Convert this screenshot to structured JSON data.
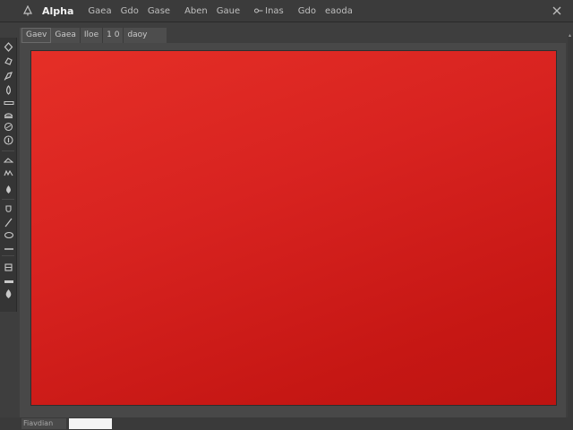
{
  "menubar": {
    "items": [
      {
        "label": "Alpha",
        "active": true
      },
      {
        "label": "Gaea"
      },
      {
        "label": "Gdo"
      },
      {
        "label": "Gase"
      },
      {
        "label": "Aben"
      },
      {
        "label": "Gaue"
      },
      {
        "label": "Inas"
      },
      {
        "label": "Gdo"
      },
      {
        "label": "eaoda"
      }
    ],
    "app_icon": "tree-icon",
    "window_control": "close-icon"
  },
  "options": {
    "items": [
      {
        "label": "Gaev"
      },
      {
        "label": "Gaea"
      },
      {
        "label": "Iloe"
      },
      {
        "label": "1 0"
      },
      {
        "label": "daoy"
      }
    ]
  },
  "toolbar": {
    "tools": [
      {
        "name": "move-tool",
        "icon": "move-icon"
      },
      {
        "name": "marquee-tool",
        "icon": "marquee-icon"
      },
      {
        "name": "lasso-tool",
        "icon": "lasso-icon"
      },
      {
        "name": "brush-tool",
        "icon": "brush-icon"
      },
      {
        "name": "line-tool",
        "icon": "line-icon"
      },
      {
        "name": "stamp-tool",
        "icon": "stamp-icon"
      },
      {
        "name": "eraser-tool",
        "icon": "eraser-icon"
      },
      {
        "name": "info-tool",
        "icon": "info-icon"
      },
      {
        "name": "shape-tool",
        "icon": "shape-icon"
      },
      {
        "name": "path-tool",
        "icon": "path-icon"
      },
      {
        "name": "fill-tool",
        "icon": "fill-icon"
      },
      {
        "name": "dodge-tool",
        "icon": "dodge-icon"
      },
      {
        "name": "pen-tool",
        "icon": "pen-icon"
      },
      {
        "name": "text-tool",
        "icon": "text-icon"
      },
      {
        "name": "hand-tool",
        "icon": "hand-icon"
      },
      {
        "name": "zoom-tool",
        "icon": "zoom-icon"
      },
      {
        "name": "color-tool",
        "icon": "color-icon"
      },
      {
        "name": "mask-tool",
        "icon": "mask-icon"
      }
    ]
  },
  "canvas": {
    "fill_color": "#d82320"
  },
  "status": {
    "label": "Fiavdian"
  },
  "colors": {
    "background": "#3e3e3e",
    "panel": "#4d4d4d",
    "canvas_red": "#d82320"
  }
}
